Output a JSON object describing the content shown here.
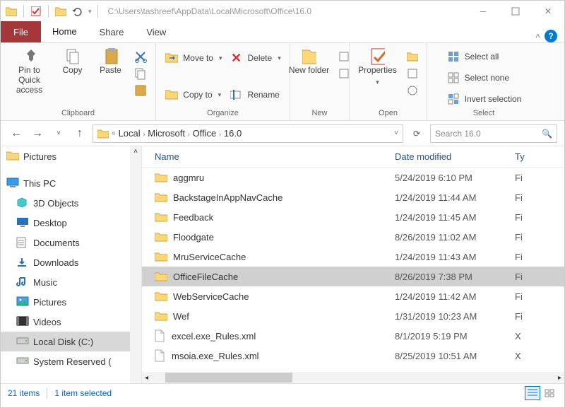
{
  "title_path": "C:\\Users\\tashreef\\AppData\\Local\\Microsoft\\Office\\16.0",
  "tabs": {
    "file": "File",
    "home": "Home",
    "share": "Share",
    "view": "View"
  },
  "ribbon": {
    "clipboard": {
      "pin": "Pin to Quick access",
      "copy": "Copy",
      "paste": "Paste",
      "group": "Clipboard"
    },
    "organize": {
      "moveto": "Move to",
      "copyto": "Copy to",
      "delete": "Delete",
      "rename": "Rename",
      "group": "Organize"
    },
    "newgrp": {
      "newfolder": "New folder",
      "group": "New"
    },
    "open": {
      "properties": "Properties",
      "group": "Open"
    },
    "select": {
      "all": "Select all",
      "none": "Select none",
      "invert": "Invert selection",
      "group": "Select"
    }
  },
  "breadcrumb": [
    "Local",
    "Microsoft",
    "Office",
    "16.0"
  ],
  "search_placeholder": "Search 16.0",
  "tree": [
    {
      "label": "Pictures",
      "type": "folder",
      "indent": "root"
    },
    {
      "label": "This PC",
      "type": "pc",
      "indent": "root"
    },
    {
      "label": "3D Objects",
      "type": "3d"
    },
    {
      "label": "Desktop",
      "type": "desktop"
    },
    {
      "label": "Documents",
      "type": "docs"
    },
    {
      "label": "Downloads",
      "type": "downloads"
    },
    {
      "label": "Music",
      "type": "music"
    },
    {
      "label": "Pictures",
      "type": "pics"
    },
    {
      "label": "Videos",
      "type": "videos"
    },
    {
      "label": "Local Disk (C:)",
      "type": "disk",
      "selected": true
    },
    {
      "label": "System Reserved (",
      "type": "disk"
    }
  ],
  "columns": {
    "name": "Name",
    "date": "Date modified",
    "type": "Ty"
  },
  "rows": [
    {
      "name": "aggmru",
      "date": "5/24/2019 6:10 PM",
      "type": "Fi",
      "kind": "folder"
    },
    {
      "name": "BackstageInAppNavCache",
      "date": "1/24/2019 11:44 AM",
      "type": "Fi",
      "kind": "folder"
    },
    {
      "name": "Feedback",
      "date": "1/24/2019 11:45 AM",
      "type": "Fi",
      "kind": "folder"
    },
    {
      "name": "Floodgate",
      "date": "8/26/2019 11:02 AM",
      "type": "Fi",
      "kind": "folder"
    },
    {
      "name": "MruServiceCache",
      "date": "1/24/2019 11:43 AM",
      "type": "Fi",
      "kind": "folder"
    },
    {
      "name": "OfficeFileCache",
      "date": "8/26/2019 7:38 PM",
      "type": "Fi",
      "kind": "folder",
      "selected": true
    },
    {
      "name": "WebServiceCache",
      "date": "1/24/2019 11:42 AM",
      "type": "Fi",
      "kind": "folder"
    },
    {
      "name": "Wef",
      "date": "1/31/2019 10:23 AM",
      "type": "Fi",
      "kind": "folder"
    },
    {
      "name": "excel.exe_Rules.xml",
      "date": "8/1/2019 5:19 PM",
      "type": "X",
      "kind": "file"
    },
    {
      "name": "msoia.exe_Rules.xml",
      "date": "8/25/2019 10:51 AM",
      "type": "X",
      "kind": "file"
    }
  ],
  "status": {
    "items": "21 items",
    "selected": "1 item selected"
  }
}
